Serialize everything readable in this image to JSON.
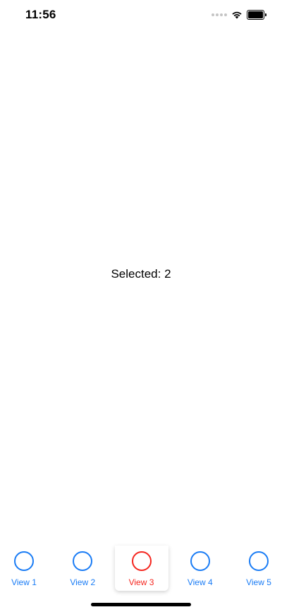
{
  "status_bar": {
    "time": "11:56",
    "icons": [
      "cellular-signal-icon",
      "wifi-icon",
      "battery-icon"
    ],
    "battery_level": 1.0
  },
  "main": {
    "selected_text": "Selected: 2"
  },
  "tab_bar": {
    "selected_index": 2,
    "accent_color": "#1a7cf5",
    "selected_color": "#f5261f",
    "tabs": [
      {
        "label": "View 1",
        "icon": "circle-icon"
      },
      {
        "label": "View 2",
        "icon": "circle-icon"
      },
      {
        "label": "View 3",
        "icon": "circle-icon"
      },
      {
        "label": "View 4",
        "icon": "circle-icon"
      },
      {
        "label": "View 5",
        "icon": "circle-icon"
      }
    ]
  }
}
